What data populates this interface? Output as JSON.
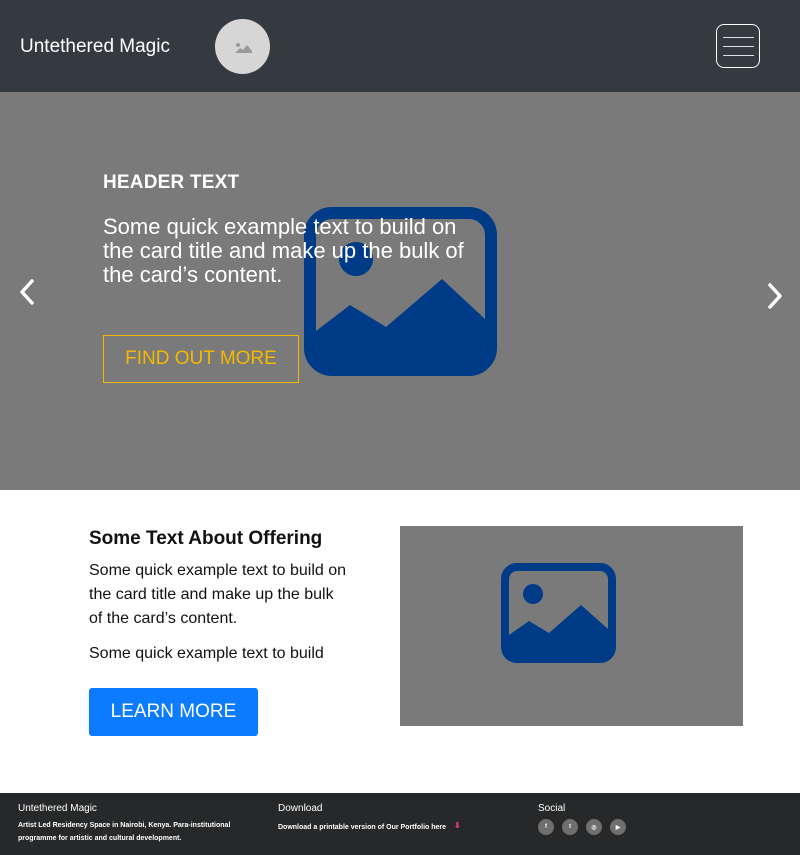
{
  "navbar": {
    "brand": "Untethered Magic",
    "avatar_icon": "image-icon",
    "menu_icon": "hamburger-icon"
  },
  "carousel": {
    "title": "HEADER TEXT",
    "text": "Some quick example text to build on the card title and make up the bulk of the card’s content.",
    "button": "FIND OUT MORE",
    "prev_icon": "chevron-left-icon",
    "next_icon": "chevron-right-icon",
    "background_icon": "image-icon"
  },
  "offering": {
    "title": "Some Text About Offering",
    "text": "Some quick example text to build on the card title and make up the bulk of the card’s content.",
    "text2": "Some quick example text to build",
    "button": "LEARN MORE",
    "image_icon": "image-icon"
  },
  "footer": {
    "col1": {
      "heading": "Untethered Magic",
      "text": "Artist Led Residency Space in Nairobi, Kenya. Para-institutional programme for artistic and cultural development."
    },
    "col2": {
      "heading": "Download",
      "text": "Download a printable version of Our Portfolio here",
      "icon": "download-icon"
    },
    "col3": {
      "heading": "Social",
      "icons": [
        {
          "name": "facebook-icon",
          "glyph": "f"
        },
        {
          "name": "twitter-icon",
          "glyph": "t"
        },
        {
          "name": "instagram-icon",
          "glyph": "◎"
        },
        {
          "name": "youtube-icon",
          "glyph": "▶"
        }
      ]
    }
  },
  "colors": {
    "navbar_bg": "#343a40",
    "carousel_bg": "#7a7a7a",
    "image_icon": "#003b87",
    "outline_button": "#f5b800",
    "primary_button": "#0d7bff",
    "footer_bg": "#272829",
    "download_icon": "#e0347a"
  }
}
